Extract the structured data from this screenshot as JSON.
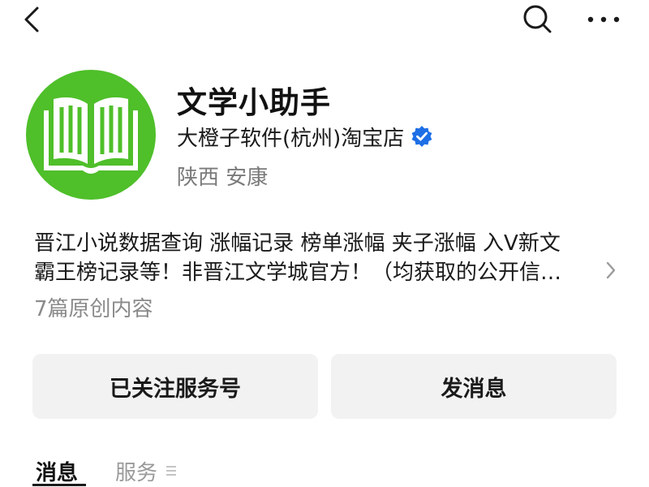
{
  "topbar": {
    "back_icon": "chevron-left-icon",
    "search_icon": "search-icon",
    "more_icon": "more-horizontal-icon"
  },
  "profile": {
    "avatar_icon": "open-book-icon",
    "avatar_color": "#4fbf2a",
    "name": "文学小助手",
    "owner": "大橙子软件(杭州)淘宝店",
    "verified_icon": "verified-badge-icon",
    "verified_color": "#1e6fe6",
    "location": "陕西 安康"
  },
  "description": {
    "line1": "晋江小说数据查询 涨幅记录 榜单涨幅 夹子涨幅 入V新文",
    "line2": "霸王榜记录等！非晋江文学城官方！（均获取的公开信…",
    "expand_icon": "chevron-right-icon"
  },
  "article_count": "7篇原创内容",
  "actions": {
    "follow_label": "已关注服务号",
    "message_label": "发消息"
  },
  "tabs": {
    "messages_label": "消息",
    "services_label": "服务",
    "services_icon": "menu-lines-icon"
  }
}
